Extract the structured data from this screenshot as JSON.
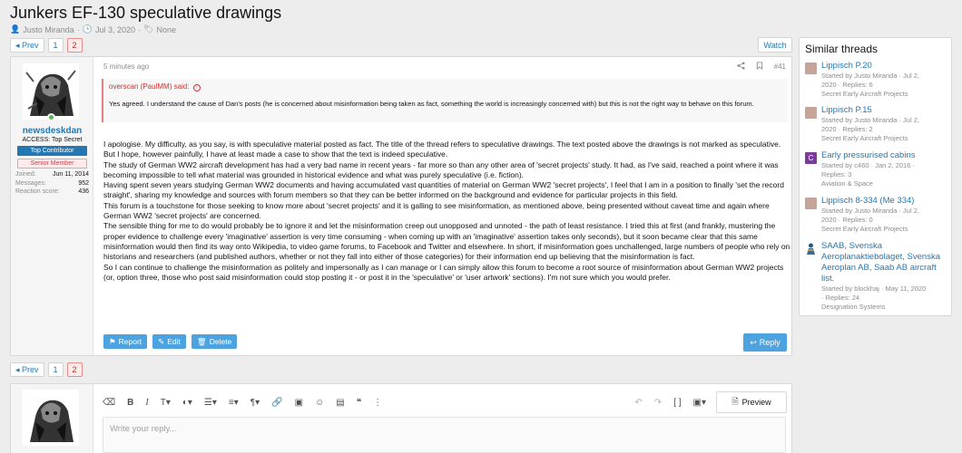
{
  "thread": {
    "title": "Junkers EF-130 speculative drawings",
    "author": "Justo Miranda",
    "date": "Jul 3, 2020",
    "tags": "None"
  },
  "pagination": {
    "prev_label": "◂ Prev",
    "pages": [
      "1",
      "2"
    ],
    "current": "2"
  },
  "watch_label": "Watch",
  "post": {
    "username": "newsdeskdan",
    "user_title": "ACCESS: Top Secret",
    "banner_1": "Top Contributor",
    "banner_2": "Senior Member",
    "stats": [
      {
        "label": "Joined:",
        "value": "Jun 11, 2014"
      },
      {
        "label": "Messages:",
        "value": "952"
      },
      {
        "label": "Reaction score:",
        "value": "436"
      }
    ],
    "time": "5 minutes ago",
    "number": "#41",
    "quote_author": "overscan (PaulMM) said:",
    "quote_text": "Yes agreed. I understand the cause of Dan's posts (he is concerned about misinformation being taken as fact, something the world is increasingly concerned with) but this is not the right way to behave on this forum.",
    "paragraphs": [
      "I apologise. My difficulty, as you say, is with speculative material posted as fact. The title of the thread refers to speculative drawings. The text posted above the drawings is not marked as speculative. But I hope, however painfully, I have at least made a case to show that the text is indeed speculative.",
      "The study of German WW2 aircraft development has had a very bad name in recent years - far more so than any other area of 'secret projects' study. It had, as I've said, reached a point where it was becoming impossible to tell what material was grounded in historical evidence and what was purely speculative (i.e. fiction).",
      "Having spent seven years studying German WW2 documents and having accumulated vast quantities of material on German WW2 'secret projects', I feel that I am in a position to finally 'set the record straight', sharing my knowledge and sources with forum members so that they can be better informed on the background and evidence for particular projects in this field.",
      "This forum is a touchstone for those seeking to know more about 'secret projects' and it is galling to see misinformation, as mentioned above, being presented without caveat time and again where German WW2 'secret projects' are concerned.",
      "The sensible thing for me to do would probably be to ignore it and let the misinformation creep out unopposed and unnoted - the path of least resistance. I tried this at first (and frankly, mustering the proper evidence to challenge every 'imaginative' assertion is very time consuming - when coming up with an 'imaginative' assertion takes only seconds), but it soon became clear that this same misinformation would then find its way onto Wikipedia, to video game forums, to Facebook and Twitter and elsewhere. In short, if misinformation goes unchallenged, large numbers of people who rely on historians and researchers (and published authors, whether or not they fall into either of those categories) for their information end up believing that the misinformation is fact.",
      "So I can continue to challenge the misinformation as politely and impersonally as I can manage or I can simply allow this forum to become a root source of misinformation about German WW2 projects (or, option three, those who post said misinformation could stop posting it - or post it in the 'speculative' or 'user artwork' sections). I'm not sure which you would prefer."
    ],
    "report_label": "Report",
    "edit_label": "Edit",
    "delete_label": "Delete",
    "reply_label": "Reply"
  },
  "sidebar": {
    "title": "Similar threads",
    "items": [
      {
        "title": "Lippisch P.20",
        "meta1": "Started by Justo Miranda · Jul 2,",
        "meta2": "2020 · Replies: 6",
        "meta3": "Secret Early Aircraft Projects",
        "avatar_color": "#c7a49a",
        "avatar_letter": ""
      },
      {
        "title": "Lippisch P.15",
        "meta1": "Started by Justo Miranda · Jul 2,",
        "meta2": "2020 · Replies: 2",
        "meta3": "Secret Early Aircraft Projects",
        "avatar_color": "#c7a49a",
        "avatar_letter": ""
      },
      {
        "title": "Early pressurised cabins",
        "meta1": "Started by c460 · Jan 2, 2016 ·",
        "meta2": "Replies: 3",
        "meta3": "Aviation & Space",
        "avatar_color": "#7a3d99",
        "avatar_letter": "C"
      },
      {
        "title": "Lippisch 8-334 (Me 334)",
        "meta1": "Started by Justo Miranda · Jul 2,",
        "meta2": "2020 · Replies: 0",
        "meta3": "Secret Early Aircraft Projects",
        "avatar_color": "#c7a49a",
        "avatar_letter": ""
      },
      {
        "title": "SAAB, Svenska Aeroplanaktiebolaget, Svenska Aeroplan AB, Saab AB aircraft list.",
        "meta1": "Started by blockhaj · May 11, 2020",
        "meta2": "· Replies: 24",
        "meta3": "Designation Systems",
        "avatar_color": "#3b6b8f",
        "avatar_letter": ""
      }
    ]
  },
  "editor": {
    "placeholder": "Write your reply...",
    "preview_label": "Preview"
  },
  "colors": {
    "accent": "#2577b1",
    "button": "#4da3df",
    "current_page": "#b42b2b"
  }
}
